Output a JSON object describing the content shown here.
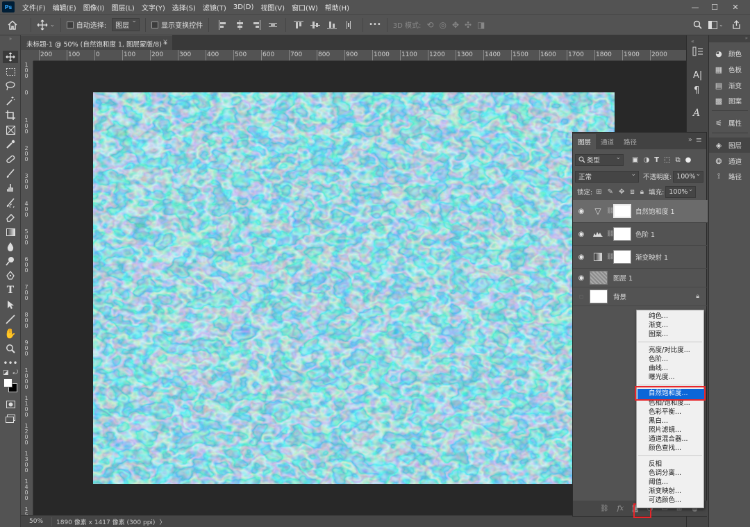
{
  "app": {
    "logo": "Ps"
  },
  "menubar": {
    "items": [
      "文件(F)",
      "编辑(E)",
      "图像(I)",
      "图层(L)",
      "文字(Y)",
      "选择(S)",
      "滤镜(T)",
      "3D(D)",
      "视图(V)",
      "窗口(W)",
      "帮助(H)"
    ],
    "window_controls": [
      "—",
      "☐",
      "✕"
    ]
  },
  "options": {
    "auto_select_label": "自动选择:",
    "auto_select_value": "图层",
    "show_transform_label": "显示变换控件",
    "more": "•••",
    "mode_3d_label": "3D 模式:"
  },
  "document": {
    "tab_title": "未标题-1 @ 50% (自然饱和度 1, 图层蒙版/8) *",
    "close": "×"
  },
  "ruler": {
    "h_ticks": [
      "200",
      "100",
      "0",
      "100",
      "200",
      "300",
      "400",
      "500",
      "600",
      "700",
      "800",
      "900",
      "1000",
      "1100",
      "1200",
      "1300",
      "1400",
      "1500",
      "1600",
      "1700",
      "1800",
      "1900",
      "2000"
    ],
    "v_ticks": [
      "1 0 0",
      "0",
      "1 0 0",
      "2 0 0",
      "3 0 0",
      "4 0 0",
      "5 0 0",
      "6 0 0",
      "7 0 0",
      "8 0 0",
      "9 0 0",
      "1 0 0 0",
      "1 1 0 0",
      "1 2 0 0",
      "1 3 0 0",
      "1 4 0 0",
      "1 5 0 0"
    ]
  },
  "status": {
    "zoom": "50%",
    "doc_info": "1890 像素 x 1417 像素 (300 ppi)",
    "arrow": "〉"
  },
  "dock": {
    "items": [
      {
        "label": "颜色",
        "icon": "color-palette-icon"
      },
      {
        "label": "色板",
        "icon": "swatches-icon"
      },
      {
        "label": "渐变",
        "icon": "gradient-icon"
      },
      {
        "label": "图案",
        "icon": "pattern-icon"
      },
      {
        "label": "属性",
        "icon": "properties-icon"
      },
      {
        "label": "图层",
        "icon": "layers-icon"
      },
      {
        "label": "通道",
        "icon": "channels-icon"
      },
      {
        "label": "路径",
        "icon": "paths-icon"
      }
    ]
  },
  "layers_panel": {
    "tabs": [
      "图层",
      "通道",
      "路径"
    ],
    "filter_kind": "类型",
    "blend_mode": "正常",
    "opacity_label": "不透明度:",
    "opacity_value": "100%",
    "lock_label": "锁定:",
    "fill_label": "填充:",
    "fill_value": "100%",
    "layers": [
      {
        "name": "自然饱和度 1",
        "type": "adjustment",
        "visible": true,
        "active": true,
        "icon": "▽"
      },
      {
        "name": "色阶 1",
        "type": "adjustment",
        "visible": true,
        "active": false,
        "icon": "levels"
      },
      {
        "name": "渐变映射 1",
        "type": "adjustment",
        "visible": true,
        "active": false,
        "icon": "gradient-map"
      },
      {
        "name": "图层 1",
        "type": "pixel",
        "visible": true,
        "active": false
      },
      {
        "name": "背景",
        "type": "background",
        "visible": false,
        "active": false,
        "locked": true
      }
    ],
    "bottom_icons": [
      "link-icon",
      "fx-icon",
      "mask-icon",
      "adjustment-icon",
      "group-icon",
      "new-layer-icon",
      "trash-icon"
    ],
    "fx_label": "fx"
  },
  "adjustment_menu": {
    "group1": [
      "纯色...",
      "渐变...",
      "图案..."
    ],
    "group2": [
      "亮度/对比度...",
      "色阶...",
      "曲线...",
      "曝光度..."
    ],
    "group3": [
      "自然饱和度...",
      "色相/饱和度...",
      "色彩平衡...",
      "黑白...",
      "照片滤镜...",
      "通道混合器...",
      "颜色查找..."
    ],
    "group4": [
      "反相",
      "色调分离...",
      "阈值...",
      "渐变映射...",
      "可选颜色..."
    ],
    "highlighted": "自然饱和度..."
  },
  "colors": {
    "highlight": "#0b66d8",
    "annotation_red": "#e8262b",
    "water": "#25a9c2"
  }
}
